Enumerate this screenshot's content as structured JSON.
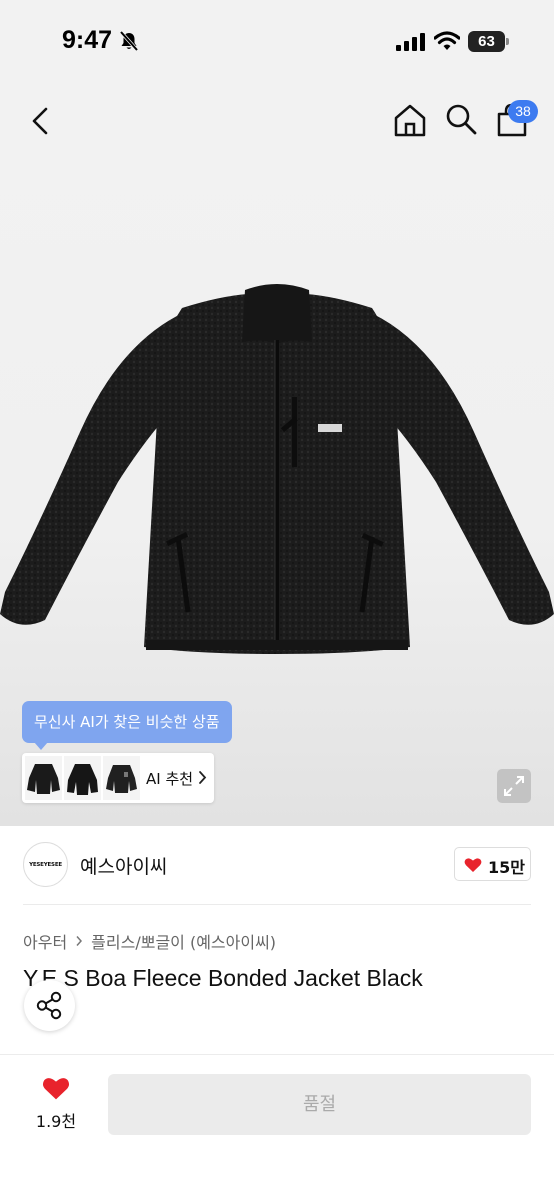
{
  "status_bar": {
    "time": "9:47",
    "battery": "63"
  },
  "header": {
    "cart_count": "38"
  },
  "ai_recommend": {
    "tooltip": "무신사 AI가 찾은 비슷한 상품",
    "button_label": "AI 추천"
  },
  "brand": {
    "name": "예스아이씨",
    "logo_text": "YESEYESEE",
    "like_count": "15만"
  },
  "breadcrumb": {
    "category": "아우터",
    "subcategory": "플리스/뽀글이 (예스아이씨)"
  },
  "product": {
    "title": "Y.E.S Boa Fleece Bonded Jacket Black"
  },
  "bottom_bar": {
    "like_count": "1.9천",
    "buy_label": "품절"
  },
  "colors": {
    "accent_blue": "#3d7bf0",
    "tooltip_blue": "#7fa5ef",
    "heart_red": "#e8232c",
    "soldout_bg": "#ebebeb"
  }
}
